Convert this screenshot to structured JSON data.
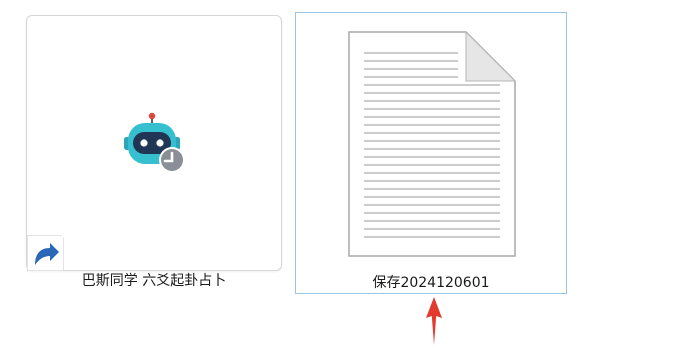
{
  "desktop": {
    "items": [
      {
        "label": "巴斯同学 六爻起卦占卜",
        "icon": "robot-app-icon",
        "shortcut_overlay": "shortcut-arrow-icon",
        "selected": false
      },
      {
        "label": "保存2024120601",
        "icon": "text-document-icon",
        "selected": true
      }
    ]
  },
  "annotation": {
    "icon": "red-up-arrow",
    "color": "#e23b2e"
  },
  "colors": {
    "selection_border": "#99c4e6",
    "robot_primary": "#2bb7c8",
    "shortcut_blue": "#2a67b8"
  }
}
